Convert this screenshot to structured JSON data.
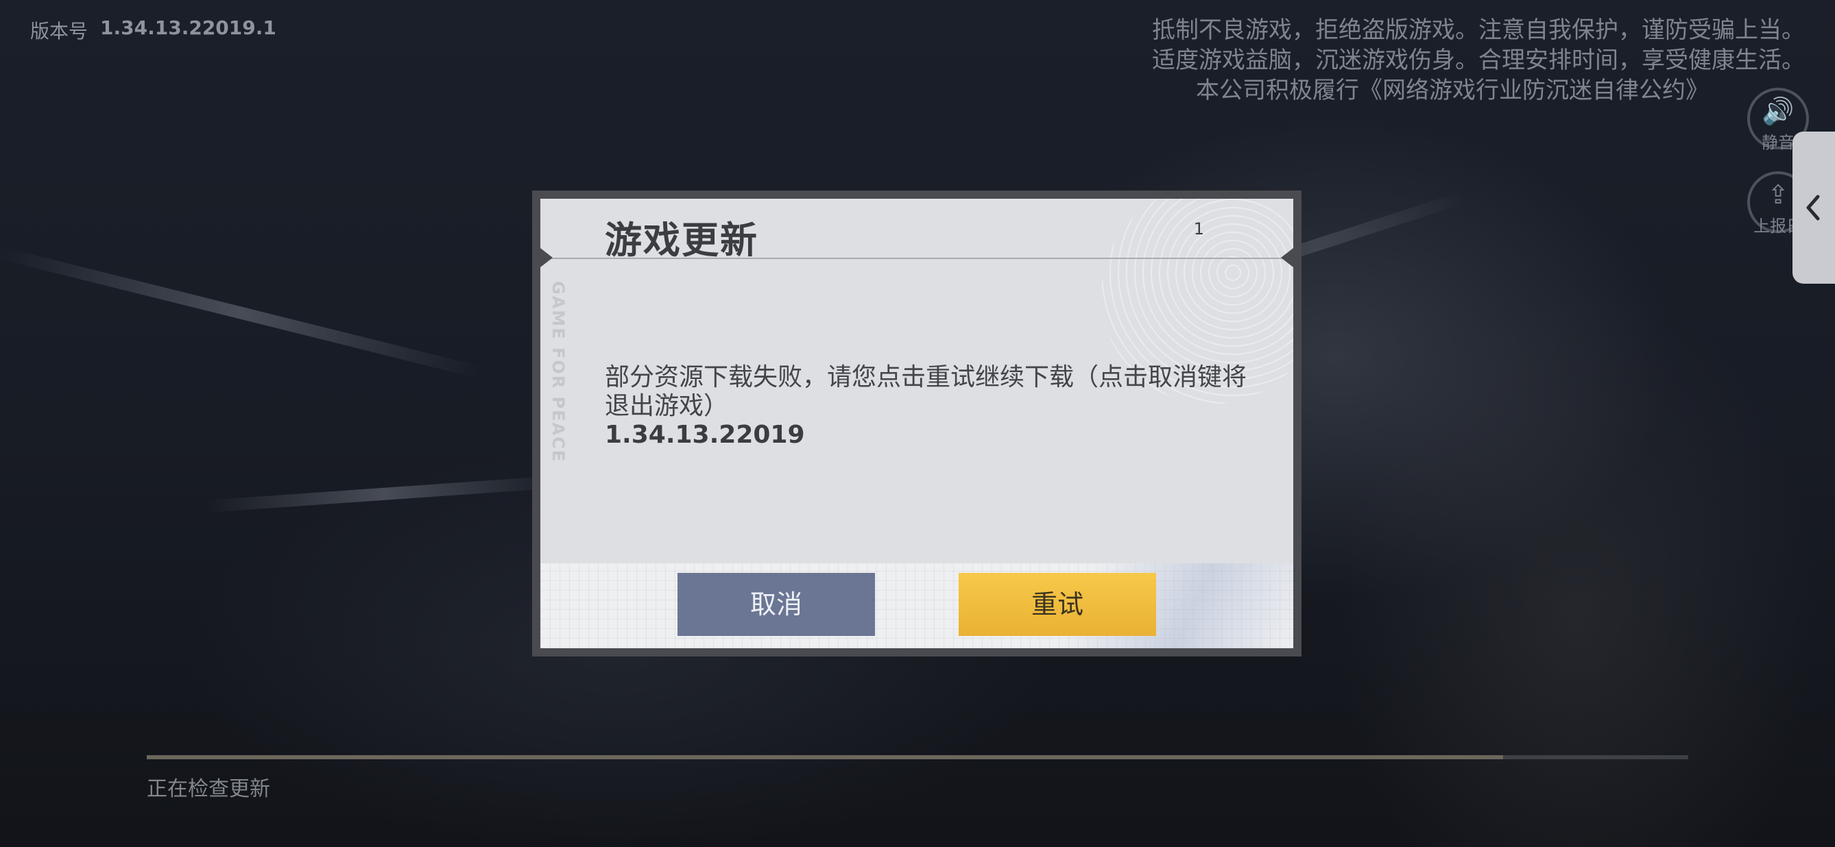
{
  "header": {
    "version_label": "版本号",
    "version_value": "1.34.13.22019.1"
  },
  "notice": [
    "抵制不良游戏，拒绝盗版游戏。注意自我保护，谨防受骗上当。",
    "适度游戏益脑，沉迷游戏伤身。合理安排时间，享受健康生活。",
    "本公司积极履行《网络游戏行业防沉迷自律公约》"
  ],
  "side_buttons": {
    "mute_label": "静音",
    "report_label": "上报日"
  },
  "dialog": {
    "title": "游戏更新",
    "count": "1",
    "side_text": "GAME FOR PEACE",
    "message": "部分资源下载失败，请您点击重试继续下载（点击取消键将退出游戏）",
    "version": "1.34.13.22019",
    "cancel_label": "取消",
    "retry_label": "重试"
  },
  "progress": {
    "status": "正在检查更新",
    "fraction": 0.88
  },
  "colors": {
    "cancel_button": "#6b7694",
    "retry_button": "#f0bd3d"
  }
}
